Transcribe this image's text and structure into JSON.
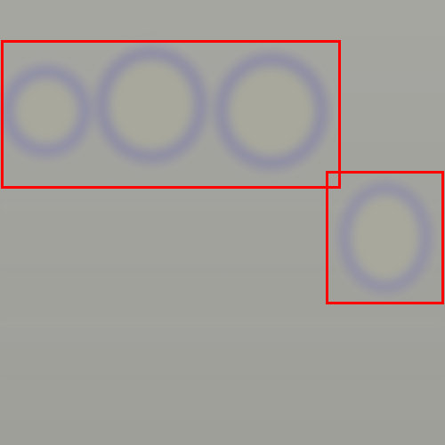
{
  "image": {
    "background_color": "#a3a39e",
    "ring_color": "#8a8aa6",
    "ring_fill_color": "#a6a69c",
    "box_color": "#ff0000"
  },
  "annotations": {
    "box_count": 2
  }
}
